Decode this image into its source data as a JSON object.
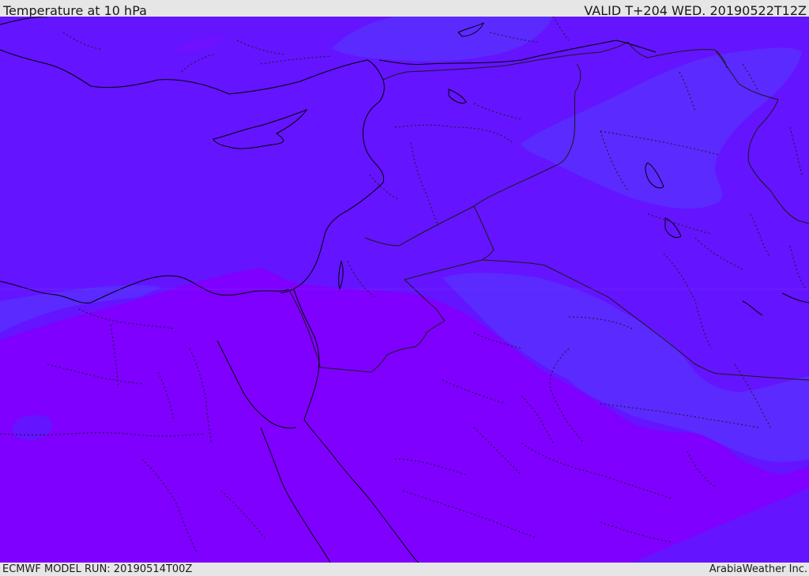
{
  "header": {
    "title": "Temperature at 10 hPa",
    "valid": "VALID T+204 WED. 20190522T12Z"
  },
  "footer": {
    "model_run": "ECMWF MODEL RUN: 20190514T00Z",
    "credit": "ArabiaWeather Inc."
  },
  "colors": {
    "band_warm": "#7f00ff",
    "band_mid": "#6414ff",
    "band_cool": "#5a2aff",
    "coastline": "#000000",
    "border": "#1a1a1a",
    "chrome": "#e6e6e6"
  }
}
